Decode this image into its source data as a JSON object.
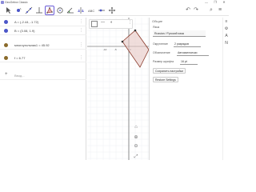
{
  "window": {
    "title": "GeoGebra Classic",
    "controls": [
      "—",
      "❐",
      "✕"
    ]
  },
  "toolbar": {
    "tools": [
      {
        "name": "move",
        "icon": "arrow-icon"
      },
      {
        "name": "point",
        "icon": "point-icon"
      },
      {
        "name": "line",
        "icon": "line-icon"
      },
      {
        "name": "perpendicular",
        "icon": "perpendicular-icon"
      },
      {
        "name": "polygon",
        "icon": "polygon-icon",
        "selected": true
      },
      {
        "name": "circle",
        "icon": "circle-icon"
      },
      {
        "name": "angle",
        "icon": "angle-icon"
      },
      {
        "name": "reflect",
        "icon": "reflect-icon"
      },
      {
        "name": "text",
        "icon": "abc-icon"
      },
      {
        "name": "slider",
        "icon": "slider-icon"
      },
      {
        "name": "move-graphics",
        "icon": "cross-arrows-icon"
      }
    ],
    "undo": "↶",
    "redo": "↷",
    "search": "⌕",
    "menu": "≡"
  },
  "algebra": {
    "rows": [
      {
        "label": "A = (-2.44, -1.72)",
        "color": "#4a55c8"
      },
      {
        "label": "B = (3.08, 1.9)",
        "color": "#4a55c8"
      },
      {
        "label": "многоугольник1 = 45.92",
        "color": "#8a6a2a"
      },
      {
        "label": "f = 6.77",
        "color": "#8a6a2a"
      }
    ],
    "input_placeholder": "Ввод..."
  },
  "graphics": {
    "x_ticks": [
      "-10",
      "-5",
      "0"
    ],
    "style_bar_labels": [
      "",
      "—",
      "◐",
      "⋮"
    ]
  },
  "properties": {
    "header": "Общие",
    "language_label": "Язык",
    "language_value": "Russian / Русский язык",
    "rounding_label": "Округление",
    "rounding_value": "2 разрядов",
    "labeling_label": "Обозначение",
    "labeling_value": "Автоматически",
    "font_size_label": "Размер шрифта",
    "font_size_value": "16 pt",
    "save_settings": "Сохранить настройки",
    "restore_settings": "Restore Settings"
  },
  "side_icons": [
    "≡",
    "⚙",
    "A",
    "N"
  ],
  "zoom_icons": [
    "⌂",
    "⊕",
    "⊖",
    "⤢"
  ]
}
